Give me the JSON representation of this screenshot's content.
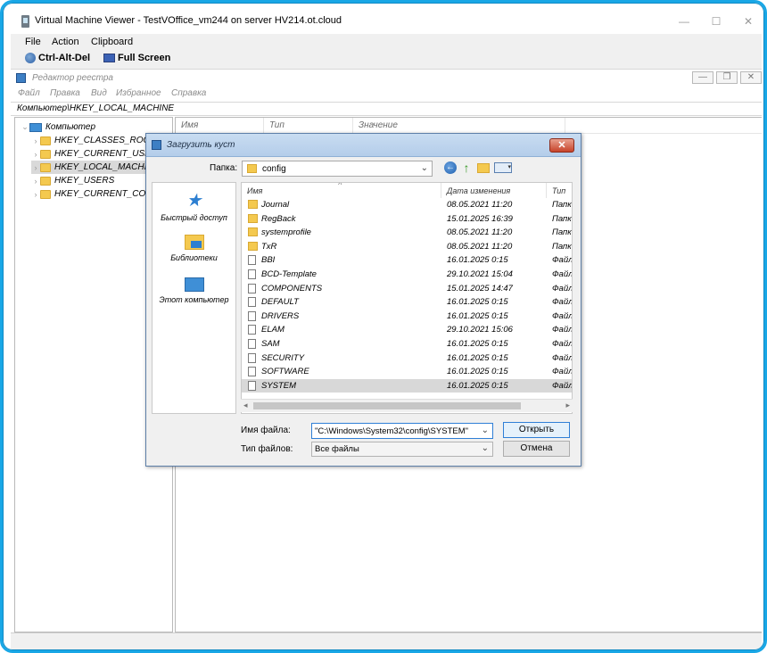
{
  "vm": {
    "title": "Virtual Machine Viewer - TestVOffice_vm244 on server HV214.ot.cloud",
    "window_controls": [
      "—",
      "☐",
      "✕"
    ],
    "menu": [
      "File",
      "Action",
      "Clipboard"
    ],
    "toolbar": {
      "cad": "Ctrl-Alt-Del",
      "fullscreen": "Full Screen"
    }
  },
  "regedit": {
    "title": "Редактор реестра",
    "window_controls": [
      "—",
      "❐",
      "✕"
    ],
    "menu": [
      "Файл",
      "Правка",
      "Вид",
      "Избранное",
      "Справка"
    ],
    "address": "Компьютер\\HKEY_LOCAL_MACHINE",
    "tree": {
      "root": "Компьютер",
      "items": [
        "HKEY_CLASSES_ROOT",
        "HKEY_CURRENT_USER",
        "HKEY_LOCAL_MACHINE",
        "HKEY_USERS",
        "HKEY_CURRENT_CONFIG"
      ],
      "selected_index": 2
    },
    "columns": [
      "Имя",
      "Тип",
      "Значение"
    ]
  },
  "dialog": {
    "title": "Загрузить куст",
    "close": "✕",
    "folder_label": "Папка:",
    "folder_value": "config",
    "places": [
      "Быстрый доступ",
      "Библиотеки",
      "Этот компьютер"
    ],
    "columns": [
      "Имя",
      "Дата изменения",
      "Тип"
    ],
    "files": [
      {
        "name": "Journal",
        "date": "08.05.2021 11:20",
        "type": "Папк",
        "kind": "folder"
      },
      {
        "name": "RegBack",
        "date": "15.01.2025 16:39",
        "type": "Папк",
        "kind": "folder"
      },
      {
        "name": "systemprofile",
        "date": "08.05.2021 11:20",
        "type": "Папк",
        "kind": "folder"
      },
      {
        "name": "TxR",
        "date": "08.05.2021 11:20",
        "type": "Папк",
        "kind": "folder"
      },
      {
        "name": "BBI",
        "date": "16.01.2025 0:15",
        "type": "Файл",
        "kind": "file"
      },
      {
        "name": "BCD-Template",
        "date": "29.10.2021 15:04",
        "type": "Файл",
        "kind": "file"
      },
      {
        "name": "COMPONENTS",
        "date": "15.01.2025 14:47",
        "type": "Файл",
        "kind": "file"
      },
      {
        "name": "DEFAULT",
        "date": "16.01.2025 0:15",
        "type": "Файл",
        "kind": "file"
      },
      {
        "name": "DRIVERS",
        "date": "16.01.2025 0:15",
        "type": "Файл",
        "kind": "file"
      },
      {
        "name": "ELAM",
        "date": "29.10.2021 15:06",
        "type": "Файл",
        "kind": "file"
      },
      {
        "name": "SAM",
        "date": "16.01.2025 0:15",
        "type": "Файл",
        "kind": "file"
      },
      {
        "name": "SECURITY",
        "date": "16.01.2025 0:15",
        "type": "Файл",
        "kind": "file"
      },
      {
        "name": "SOFTWARE",
        "date": "16.01.2025 0:15",
        "type": "Файл",
        "kind": "file"
      },
      {
        "name": "SYSTEM",
        "date": "16.01.2025 0:15",
        "type": "Файл",
        "kind": "file",
        "selected": true
      }
    ],
    "filename_label": "Имя файла:",
    "filename_value": "\"C:\\Windows\\System32\\config\\SYSTEM\"",
    "filetype_label": "Тип файлов:",
    "filetype_value": "Все файлы",
    "open_button": "Открыть",
    "cancel_button": "Отмена"
  },
  "colors": {
    "frame_border": "#19a7e6",
    "dialog_title": "#b4cdea",
    "selection": "#d8d8d8",
    "accent": "#2f7fd6"
  }
}
